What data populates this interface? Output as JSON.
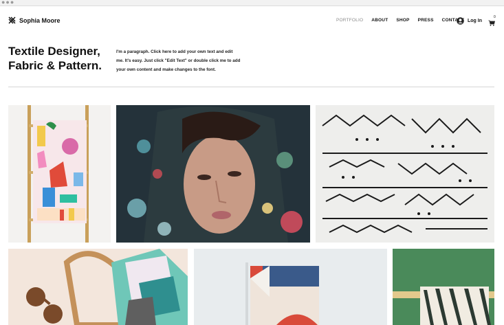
{
  "site": {
    "name": "Sophia Moore"
  },
  "nav": {
    "items": [
      "PORTFOLIO",
      "ABOUT",
      "SHOP",
      "PRESS",
      "CONTACT"
    ],
    "active": "PORTFOLIO"
  },
  "account": {
    "login_label": "Log In",
    "cart_count": "0"
  },
  "hero": {
    "headline_line1": "Textile Designer,",
    "headline_line2": "Fabric & Pattern.",
    "paragraph_lines": [
      "I'm a paragraph. Click here to add your own text and edit",
      "me. It's easy. Just click \"Edit Text\" or double click me to add",
      "your own content and make changes to the font."
    ]
  },
  "gallery": {
    "row1": [
      "towel-on-ladder",
      "woman-in-floral-scarf",
      "black-white-patterned-fabric"
    ],
    "row2": [
      "bag-scarf-sunglasses",
      "geometric-towel",
      "green-pattern-towel"
    ]
  },
  "icons": [
    "logo-mark-icon",
    "user-icon",
    "cart-icon"
  ]
}
